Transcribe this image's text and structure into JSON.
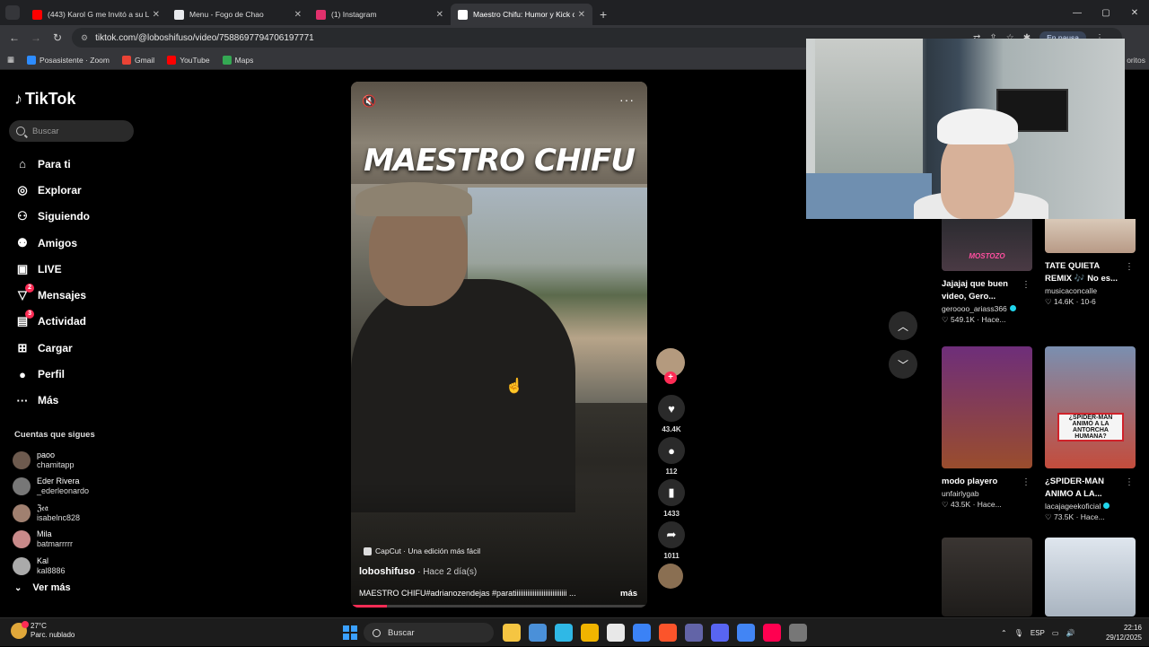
{
  "browser": {
    "tabs": [
      {
        "title": "(443) Karol G me Invitó a su Lu",
        "color": "#ff0000",
        "active": false
      },
      {
        "title": "Menu - Fogo de Chao",
        "color": "#e8eaed",
        "active": false
      },
      {
        "title": "(1) Instagram",
        "color": "#e1306c",
        "active": false
      },
      {
        "title": "Maestro Chifu: Humor y Kick co",
        "color": "#ffffff",
        "active": true
      }
    ],
    "url": "tiktok.com/@loboshifuso/video/7588697794706197771",
    "paused_label": "En pausa",
    "bookmarks": [
      {
        "label": "Posasistente · Zoom",
        "color": "#2d8cff"
      },
      {
        "label": "Gmail",
        "color": "#ea4335"
      },
      {
        "label": "YouTube",
        "color": "#ff0000"
      },
      {
        "label": "Maps",
        "color": "#34a853"
      }
    ],
    "bookmarks_overflow": "oritos"
  },
  "tiktok": {
    "brand": "TikTok",
    "search_placeholder": "Buscar",
    "nav": [
      {
        "label": "Para ti",
        "icon": "home-icon",
        "glyph": "⌂",
        "badge": ""
      },
      {
        "label": "Explorar",
        "icon": "compass-icon",
        "glyph": "◎",
        "badge": ""
      },
      {
        "label": "Siguiendo",
        "icon": "following-icon",
        "glyph": "⚇",
        "badge": ""
      },
      {
        "label": "Amigos",
        "icon": "friends-icon",
        "glyph": "⚉",
        "badge": ""
      },
      {
        "label": "LIVE",
        "icon": "live-icon",
        "glyph": "▣",
        "badge": ""
      },
      {
        "label": "Mensajes",
        "icon": "messages-icon",
        "glyph": "▽",
        "badge": "2"
      },
      {
        "label": "Actividad",
        "icon": "activity-icon",
        "glyph": "▤",
        "badge": "3"
      },
      {
        "label": "Cargar",
        "icon": "upload-icon",
        "glyph": "⊞",
        "badge": ""
      },
      {
        "label": "Perfil",
        "icon": "profile-icon",
        "glyph": "●",
        "badge": ""
      },
      {
        "label": "Más",
        "icon": "more-icon",
        "glyph": "···",
        "badge": ""
      }
    ],
    "following_header": "Cuentas que sigues",
    "following": [
      {
        "name": "paoo",
        "handle": "chamitapp",
        "color": "#6d5a4e"
      },
      {
        "name": "Eder Rivera",
        "handle": "_ederleonardo",
        "color": "#777"
      },
      {
        "name": "ℨ𝔢𝔞",
        "handle": "isabelnc828",
        "color": "#a08070"
      },
      {
        "name": "Mila",
        "handle": "batmarrrrr",
        "color": "#c98a8a"
      },
      {
        "name": "Kal",
        "handle": "kal8886",
        "color": "#aaa"
      }
    ],
    "see_more": "Ver más"
  },
  "video": {
    "overlay_title": "MAESTRO CHIFU",
    "capcut": "CapCut · Una edición más fácil",
    "author": "loboshifuso",
    "time": " · Hace 2 día(s)",
    "caption": "MAESTRO CHIFU#adrianozendejas #paratiiiiiiiiiiiiiiiiiiiiiiiiiiiii ...",
    "more_label": "más",
    "progress": 0.12
  },
  "actions": {
    "likes": "43.4K",
    "comments": "112",
    "saves": "1433",
    "shares": "1011"
  },
  "recommended": [
    {
      "title": "Jajajaj que buen video, Gero...",
      "author": "geroooo_ariass366",
      "verified": true,
      "likes": "549.1K",
      "time": "Hace...",
      "thumb_label": "MOSTOZO",
      "thumb": "linear-gradient(180deg,#2b2b30,#4a3a44)"
    },
    {
      "title": "TATE QUIETA REMIX 🎶 No es...",
      "author": "musicaconcalle",
      "verified": false,
      "likes": "14.6K",
      "time": "10-6",
      "thumb_label": "",
      "thumb": "linear-gradient(180deg,#d9c9b8,#b89a86)"
    },
    {
      "title": "modo playero",
      "author": "unfairlygab",
      "verified": false,
      "likes": "43.5K",
      "time": "Hace...",
      "thumb_label": "",
      "thumb": "linear-gradient(180deg,#6e2e7a,#9a4d2d)"
    },
    {
      "title": "¿SPIDER-MAN ANIMO A LA...",
      "author": "lacajageekoficial",
      "verified": true,
      "likes": "73.5K",
      "time": "Hace...",
      "thumb_label": "¿SPIDER-MAN ANIMÓ A LA ANTORCHA HUMANA?",
      "thumb": "linear-gradient(180deg,#7a8fb0,#c44c3c)"
    },
    {
      "title": "",
      "author": "",
      "verified": false,
      "likes": "",
      "time": "",
      "thumb_label": "",
      "thumb": "linear-gradient(180deg,#3a3532,#1e1c1a)"
    },
    {
      "title": "",
      "author": "",
      "verified": false,
      "likes": "",
      "time": "",
      "thumb_label": "",
      "thumb": "linear-gradient(180deg,#dfe6ee,#a9b4c0)"
    }
  ],
  "taskbar": {
    "temp": "27°C",
    "weather": "Parc. nublado",
    "search": "Buscar",
    "lang": "ESP",
    "time": "22:16",
    "date": "29/12/2025",
    "apps": [
      "#f5c542",
      "#4a90d9",
      "#2fb8e6",
      "#f0b400",
      "#e8e8e8",
      "#3b82f6",
      "#fb542b",
      "#6264a7",
      "#5865f2",
      "#4285f4",
      "#ff0050",
      "#777777"
    ]
  }
}
